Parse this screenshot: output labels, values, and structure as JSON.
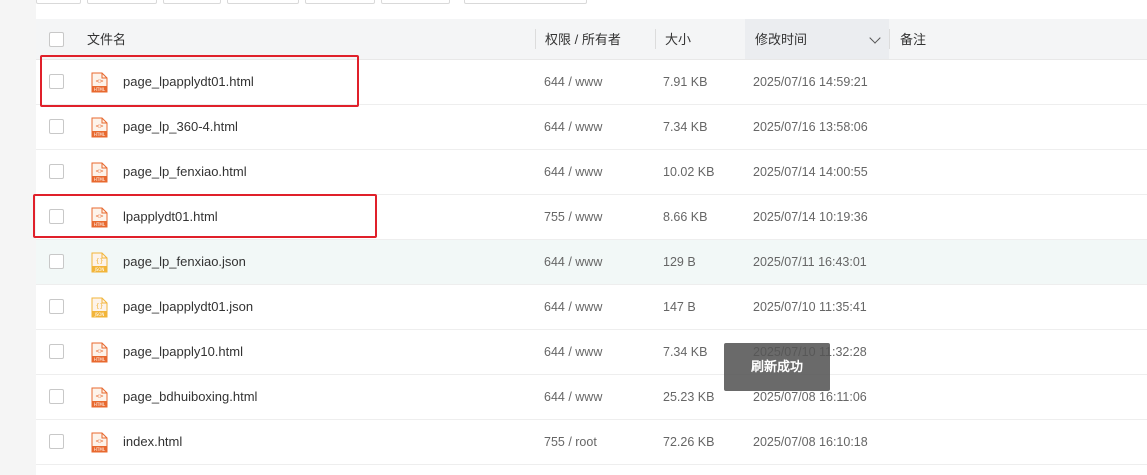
{
  "table": {
    "headers": {
      "name": "文件名",
      "permissions": "权限 / 所有者",
      "size": "大小",
      "modified": "修改时间",
      "remark": "备注"
    },
    "rows": [
      {
        "name": "page_lpapplydt01.html",
        "perm": "644 / www",
        "size": "7.91 KB",
        "mtime": "2025/07/16 14:59:21",
        "type": "html"
      },
      {
        "name": "page_lp_360-4.html",
        "perm": "644 / www",
        "size": "7.34 KB",
        "mtime": "2025/07/16 13:58:06",
        "type": "html"
      },
      {
        "name": "page_lp_fenxiao.html",
        "perm": "644 / www",
        "size": "10.02 KB",
        "mtime": "2025/07/14 14:00:55",
        "type": "html"
      },
      {
        "name": "lpapplydt01.html",
        "perm": "755 / www",
        "size": "8.66 KB",
        "mtime": "2025/07/14 10:19:36",
        "type": "html"
      },
      {
        "name": "page_lp_fenxiao.json",
        "perm": "644 / www",
        "size": "129 B",
        "mtime": "2025/07/11 16:43:01",
        "type": "json"
      },
      {
        "name": "page_lpapplydt01.json",
        "perm": "644 / www",
        "size": "147 B",
        "mtime": "2025/07/10 11:35:41",
        "type": "json"
      },
      {
        "name": "page_lpapply10.html",
        "perm": "644 / www",
        "size": "7.34 KB",
        "mtime": "2025/07/10 11:32:28",
        "type": "html"
      },
      {
        "name": "page_bdhuiboxing.html",
        "perm": "644 / www",
        "size": "25.23 KB",
        "mtime": "2025/07/08 16:11:06",
        "type": "html"
      },
      {
        "name": "index.html",
        "perm": "755 / root",
        "size": "72.26 KB",
        "mtime": "2025/07/08 16:10:18",
        "type": "html"
      }
    ]
  },
  "icons": {
    "html_label": "HTML",
    "json_label": "JSON",
    "html_glyph": "<>",
    "json_glyph": "{}"
  },
  "toast": {
    "message": "刷新成功"
  },
  "colors": {
    "highlight_box": "#e0202a",
    "html_icon": "#e8692f",
    "json_icon": "#f2b53a",
    "hover_row": "#f2f8f7"
  }
}
